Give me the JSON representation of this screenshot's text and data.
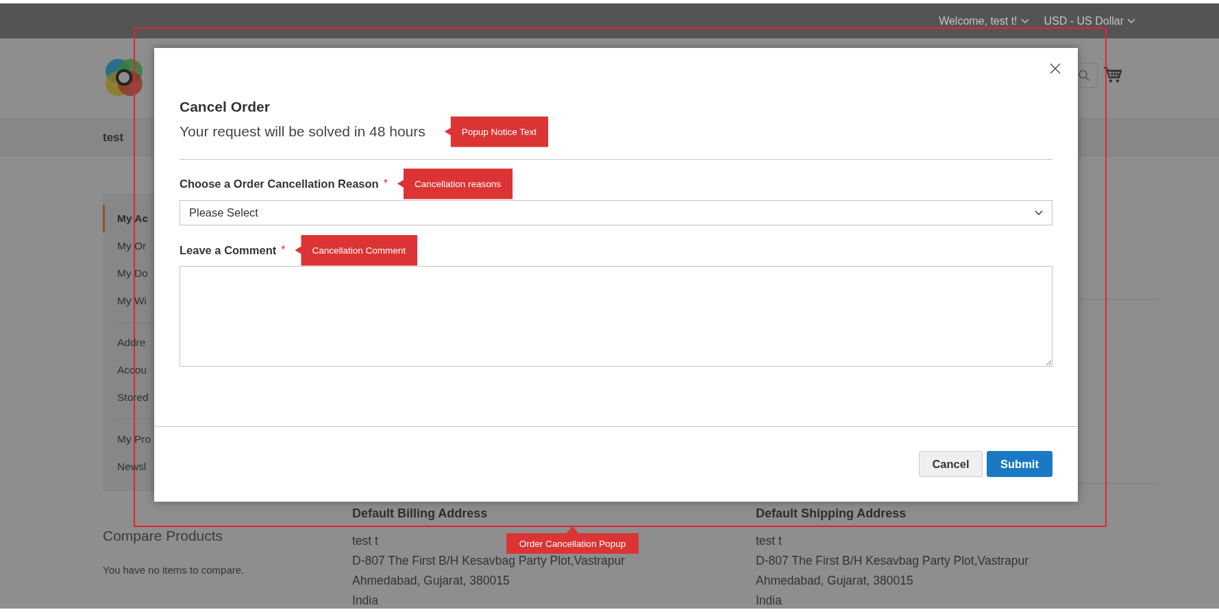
{
  "top_bar": {
    "links": [
      {
        "label": "Welcome, test t!"
      },
      {
        "label": "USD - US Dollar"
      }
    ]
  },
  "nav": {
    "items": [
      {
        "label": "test"
      }
    ]
  },
  "sidebar": {
    "groups": [
      {
        "items": [
          {
            "label": "My Ac",
            "selected": true
          },
          {
            "label": "My Or",
            "selected": false
          },
          {
            "label": "My Do",
            "selected": false
          },
          {
            "label": "My Wi",
            "selected": false
          }
        ]
      },
      {
        "items": [
          {
            "label": "Addre",
            "selected": false
          },
          {
            "label": "Accou",
            "selected": false
          },
          {
            "label": "Stored",
            "selected": false
          }
        ]
      },
      {
        "items": [
          {
            "label": "My Pro",
            "selected": false
          },
          {
            "label": "Newsl",
            "selected": false
          }
        ]
      }
    ]
  },
  "compare": {
    "title": "Compare Products",
    "message": "You have no items to compare."
  },
  "addresses": [
    {
      "title": "Default Billing Address",
      "lines": [
        "test t",
        "D-807 The First B/H Kesavbag Party Plot,Vastrapur",
        "Ahmedabad, Gujarat, 380015",
        "India"
      ]
    },
    {
      "title": "Default Shipping Address",
      "lines": [
        "test t",
        "D-807 The First B/H Kesavbag Party Plot,Vastrapur",
        "Ahmedabad, Gujarat, 380015",
        "India"
      ]
    }
  ],
  "modal": {
    "title": "Cancel Order",
    "notice": "Your request will be solved in 48 hours",
    "notice_annotation": "Popup Notice Text",
    "fields": [
      {
        "kind": "select",
        "label": "Choose a Order Cancellation Reason",
        "required_mark": "*",
        "value": "Please Select",
        "annotation": "Cancellation reasons"
      },
      {
        "kind": "textarea",
        "label": "Leave a Comment",
        "required_mark": "*",
        "annotation": "Cancellation Comment"
      }
    ],
    "buttons": [
      {
        "label": "Cancel",
        "kind": "secondary"
      },
      {
        "label": "Submit",
        "kind": "primary"
      }
    ],
    "annotation": "Order Cancellation Popup"
  }
}
